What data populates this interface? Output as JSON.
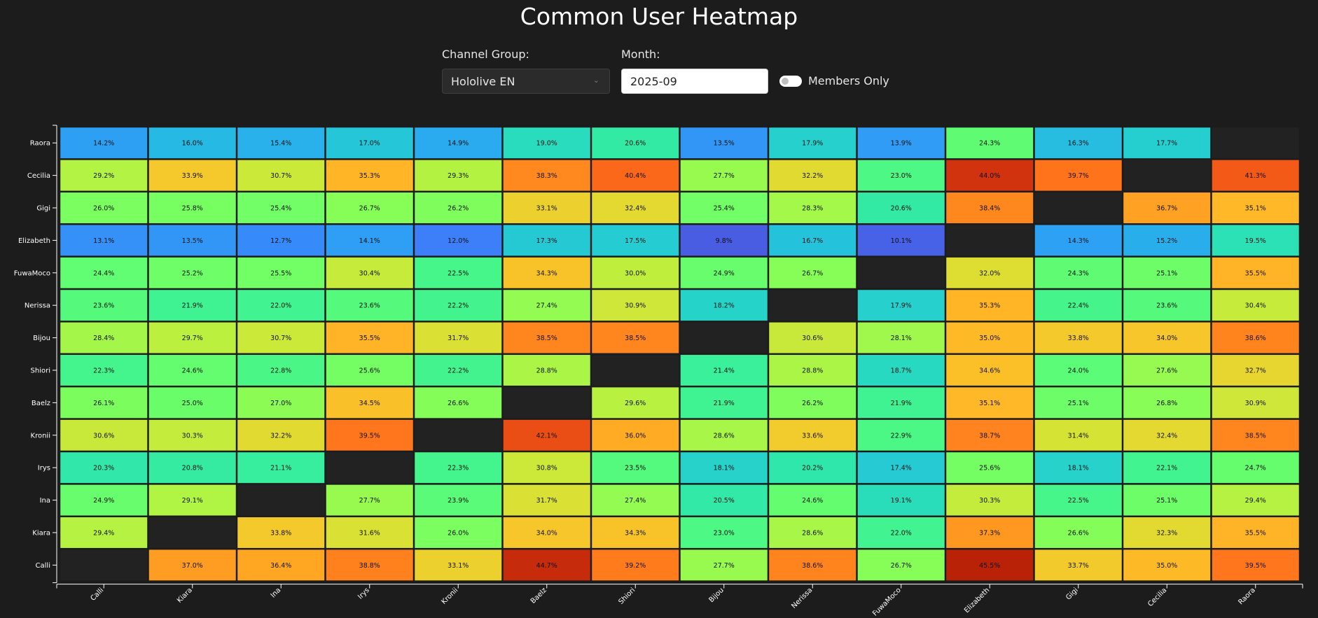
{
  "page": {
    "title": "Common User Heatmap"
  },
  "controls": {
    "channel_group_label": "Channel Group:",
    "channel_group_value": "Hololive EN",
    "month_label": "Month:",
    "month_value": "2025-09",
    "members_only_label": "Members Only",
    "members_only_checked": false
  },
  "chart_data": {
    "type": "heatmap",
    "title": "Common User Heatmap",
    "x_categories": [
      "Calli",
      "Kiara",
      "Ina",
      "Irys",
      "Kronii",
      "Baelz",
      "Shiori",
      "Bijou",
      "Nerissa",
      "FuwaMoco",
      "Elizabeth",
      "Gigi",
      "Cecilia",
      "Raora"
    ],
    "y_categories": [
      "Raora",
      "Cecilia",
      "Gigi",
      "Elizabeth",
      "FuwaMoco",
      "Nerissa",
      "Bijou",
      "Shiori",
      "Baelz",
      "Kronii",
      "Irys",
      "Ina",
      "Kiara",
      "Calli"
    ],
    "value_unit": "%",
    "colorscale": "turbo",
    "color_domain": [
      5,
      50
    ],
    "values": [
      [
        14.2,
        16.0,
        15.4,
        17.0,
        14.9,
        19.0,
        20.6,
        13.5,
        17.9,
        13.9,
        24.3,
        16.3,
        17.7,
        null
      ],
      [
        29.2,
        33.9,
        30.7,
        35.3,
        29.3,
        38.3,
        40.4,
        27.7,
        32.2,
        23.0,
        44.0,
        39.7,
        null,
        41.3
      ],
      [
        26.0,
        25.8,
        25.4,
        26.7,
        26.2,
        33.1,
        32.4,
        25.4,
        28.3,
        20.6,
        38.4,
        null,
        36.7,
        35.1
      ],
      [
        13.1,
        13.5,
        12.7,
        14.1,
        12.0,
        17.3,
        17.5,
        9.8,
        16.7,
        10.1,
        null,
        14.3,
        15.2,
        19.5
      ],
      [
        24.4,
        25.2,
        25.5,
        30.4,
        22.5,
        34.3,
        30.0,
        24.9,
        26.7,
        null,
        32.0,
        24.3,
        25.1,
        35.5
      ],
      [
        23.6,
        21.9,
        22.0,
        23.6,
        22.2,
        27.4,
        30.9,
        18.2,
        null,
        17.9,
        35.3,
        22.4,
        23.6,
        30.4
      ],
      [
        28.4,
        29.7,
        30.7,
        35.5,
        31.7,
        38.5,
        38.5,
        null,
        30.6,
        28.1,
        35.0,
        33.8,
        34.0,
        38.6
      ],
      [
        22.3,
        24.6,
        22.8,
        25.6,
        22.2,
        28.8,
        null,
        21.4,
        28.8,
        18.7,
        34.6,
        24.0,
        27.6,
        32.7
      ],
      [
        26.1,
        25.0,
        27.0,
        34.5,
        26.6,
        null,
        29.6,
        21.9,
        26.2,
        21.9,
        35.1,
        25.1,
        26.8,
        30.9
      ],
      [
        30.6,
        30.3,
        32.2,
        39.5,
        null,
        42.1,
        36.0,
        28.6,
        33.6,
        22.9,
        38.7,
        31.4,
        32.4,
        38.5
      ],
      [
        20.3,
        20.8,
        21.1,
        null,
        22.3,
        30.8,
        23.5,
        18.1,
        20.2,
        17.4,
        25.6,
        18.1,
        22.1,
        24.7
      ],
      [
        24.9,
        29.1,
        null,
        27.7,
        23.9,
        31.7,
        27.4,
        20.5,
        24.6,
        19.1,
        30.3,
        22.5,
        25.1,
        29.4
      ],
      [
        29.4,
        null,
        33.8,
        31.6,
        26.0,
        34.0,
        34.3,
        23.0,
        28.6,
        22.0,
        37.3,
        26.6,
        32.3,
        35.5
      ],
      [
        null,
        37.0,
        36.4,
        38.8,
        33.1,
        44.7,
        39.2,
        27.7,
        38.6,
        26.7,
        45.5,
        33.7,
        35.0,
        39.5
      ]
    ]
  }
}
